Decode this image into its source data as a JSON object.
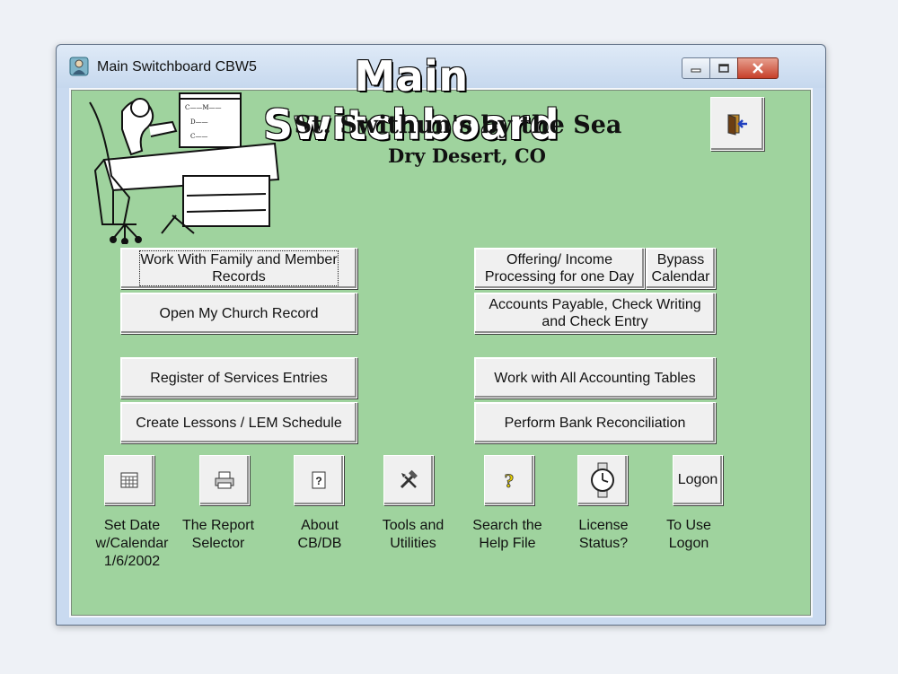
{
  "window": {
    "title": "Main Switchboard CBW5",
    "controls": {
      "minimize": "minimize",
      "maximize": "maximize",
      "close": "close"
    }
  },
  "header": {
    "title": "Main Switchboard",
    "church_name": "St. Swithun's by the Sea",
    "church_location": "Dry Desert, CO"
  },
  "buttons": {
    "family_records": "Work With Family and Member\nRecords",
    "open_church_record": "Open My Church Record",
    "register_services": "Register of Services Entries",
    "lessons_schedule": "Create Lessons / LEM Schedule",
    "offering_income": "Offering/ Income\nProcessing for one Day",
    "bypass_calendar": "Bypass\nCalendar",
    "accounts_payable": "Accounts Payable, Check Writing\nand Check Entry",
    "accounting_tables": "Work with All Accounting Tables",
    "bank_reconciliation": "Perform Bank Reconciliation"
  },
  "tools": [
    {
      "label": "Set Date\nw/Calendar\n1/6/2002",
      "icon": "calendar-icon"
    },
    {
      "label": "The Report\nSelector",
      "icon": "printer-icon"
    },
    {
      "label": "About\nCB/DB",
      "icon": "help-document-icon"
    },
    {
      "label": "Tools and\nUtilities",
      "icon": "hammer-tools-icon"
    },
    {
      "label": "Search the\nHelp File",
      "icon": "question-mark-icon"
    },
    {
      "label": "License\nStatus?",
      "icon": "stopwatch-icon"
    },
    {
      "label": "To Use\nLogon",
      "icon": "logon-text-icon",
      "button_text": "Logon"
    }
  ],
  "clipart": {
    "chart_lines": [
      "C——M——",
      "D——",
      "C——"
    ]
  },
  "colors": {
    "client_background": "#9fd39e",
    "button_face": "#f0f0f0",
    "close_red": "#c7402a"
  }
}
